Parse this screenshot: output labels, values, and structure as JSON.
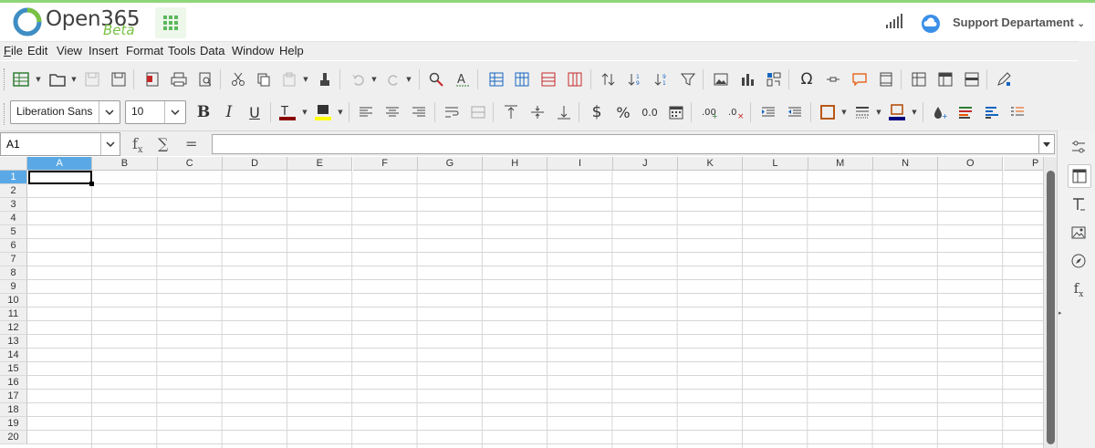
{
  "app": {
    "logo_text": "Open365",
    "logo_badge": "Beta",
    "account_name": "Support Departament",
    "accent_color": "#8ed67a"
  },
  "menu": [
    "File",
    "Edit",
    "View",
    "Insert",
    "Format",
    "Tools",
    "Data",
    "Window",
    "Help"
  ],
  "menu_accel": [
    "F",
    "E",
    "V",
    "I",
    "o",
    "T",
    "D",
    "W",
    "H"
  ],
  "format_toolbar": {
    "font_name": "Liberation Sans",
    "font_size": "10"
  },
  "formula_bar": {
    "name_box": "A1",
    "formula_value": ""
  },
  "sheet": {
    "columns": [
      "A",
      "B",
      "C",
      "D",
      "E",
      "F",
      "G",
      "H",
      "I",
      "J",
      "K",
      "L",
      "M",
      "N",
      "O",
      "P"
    ],
    "rows": [
      "1",
      "2",
      "3",
      "4",
      "5",
      "6",
      "7",
      "8",
      "9",
      "10",
      "11",
      "12",
      "13",
      "14",
      "15",
      "16",
      "17",
      "18",
      "19",
      "20"
    ],
    "selected_column": "A",
    "selected_row": "1"
  },
  "sidebar": {
    "icons": [
      "properties-icon",
      "styles-icon",
      "gallery-icon",
      "navigator-icon",
      "functions-icon"
    ]
  }
}
